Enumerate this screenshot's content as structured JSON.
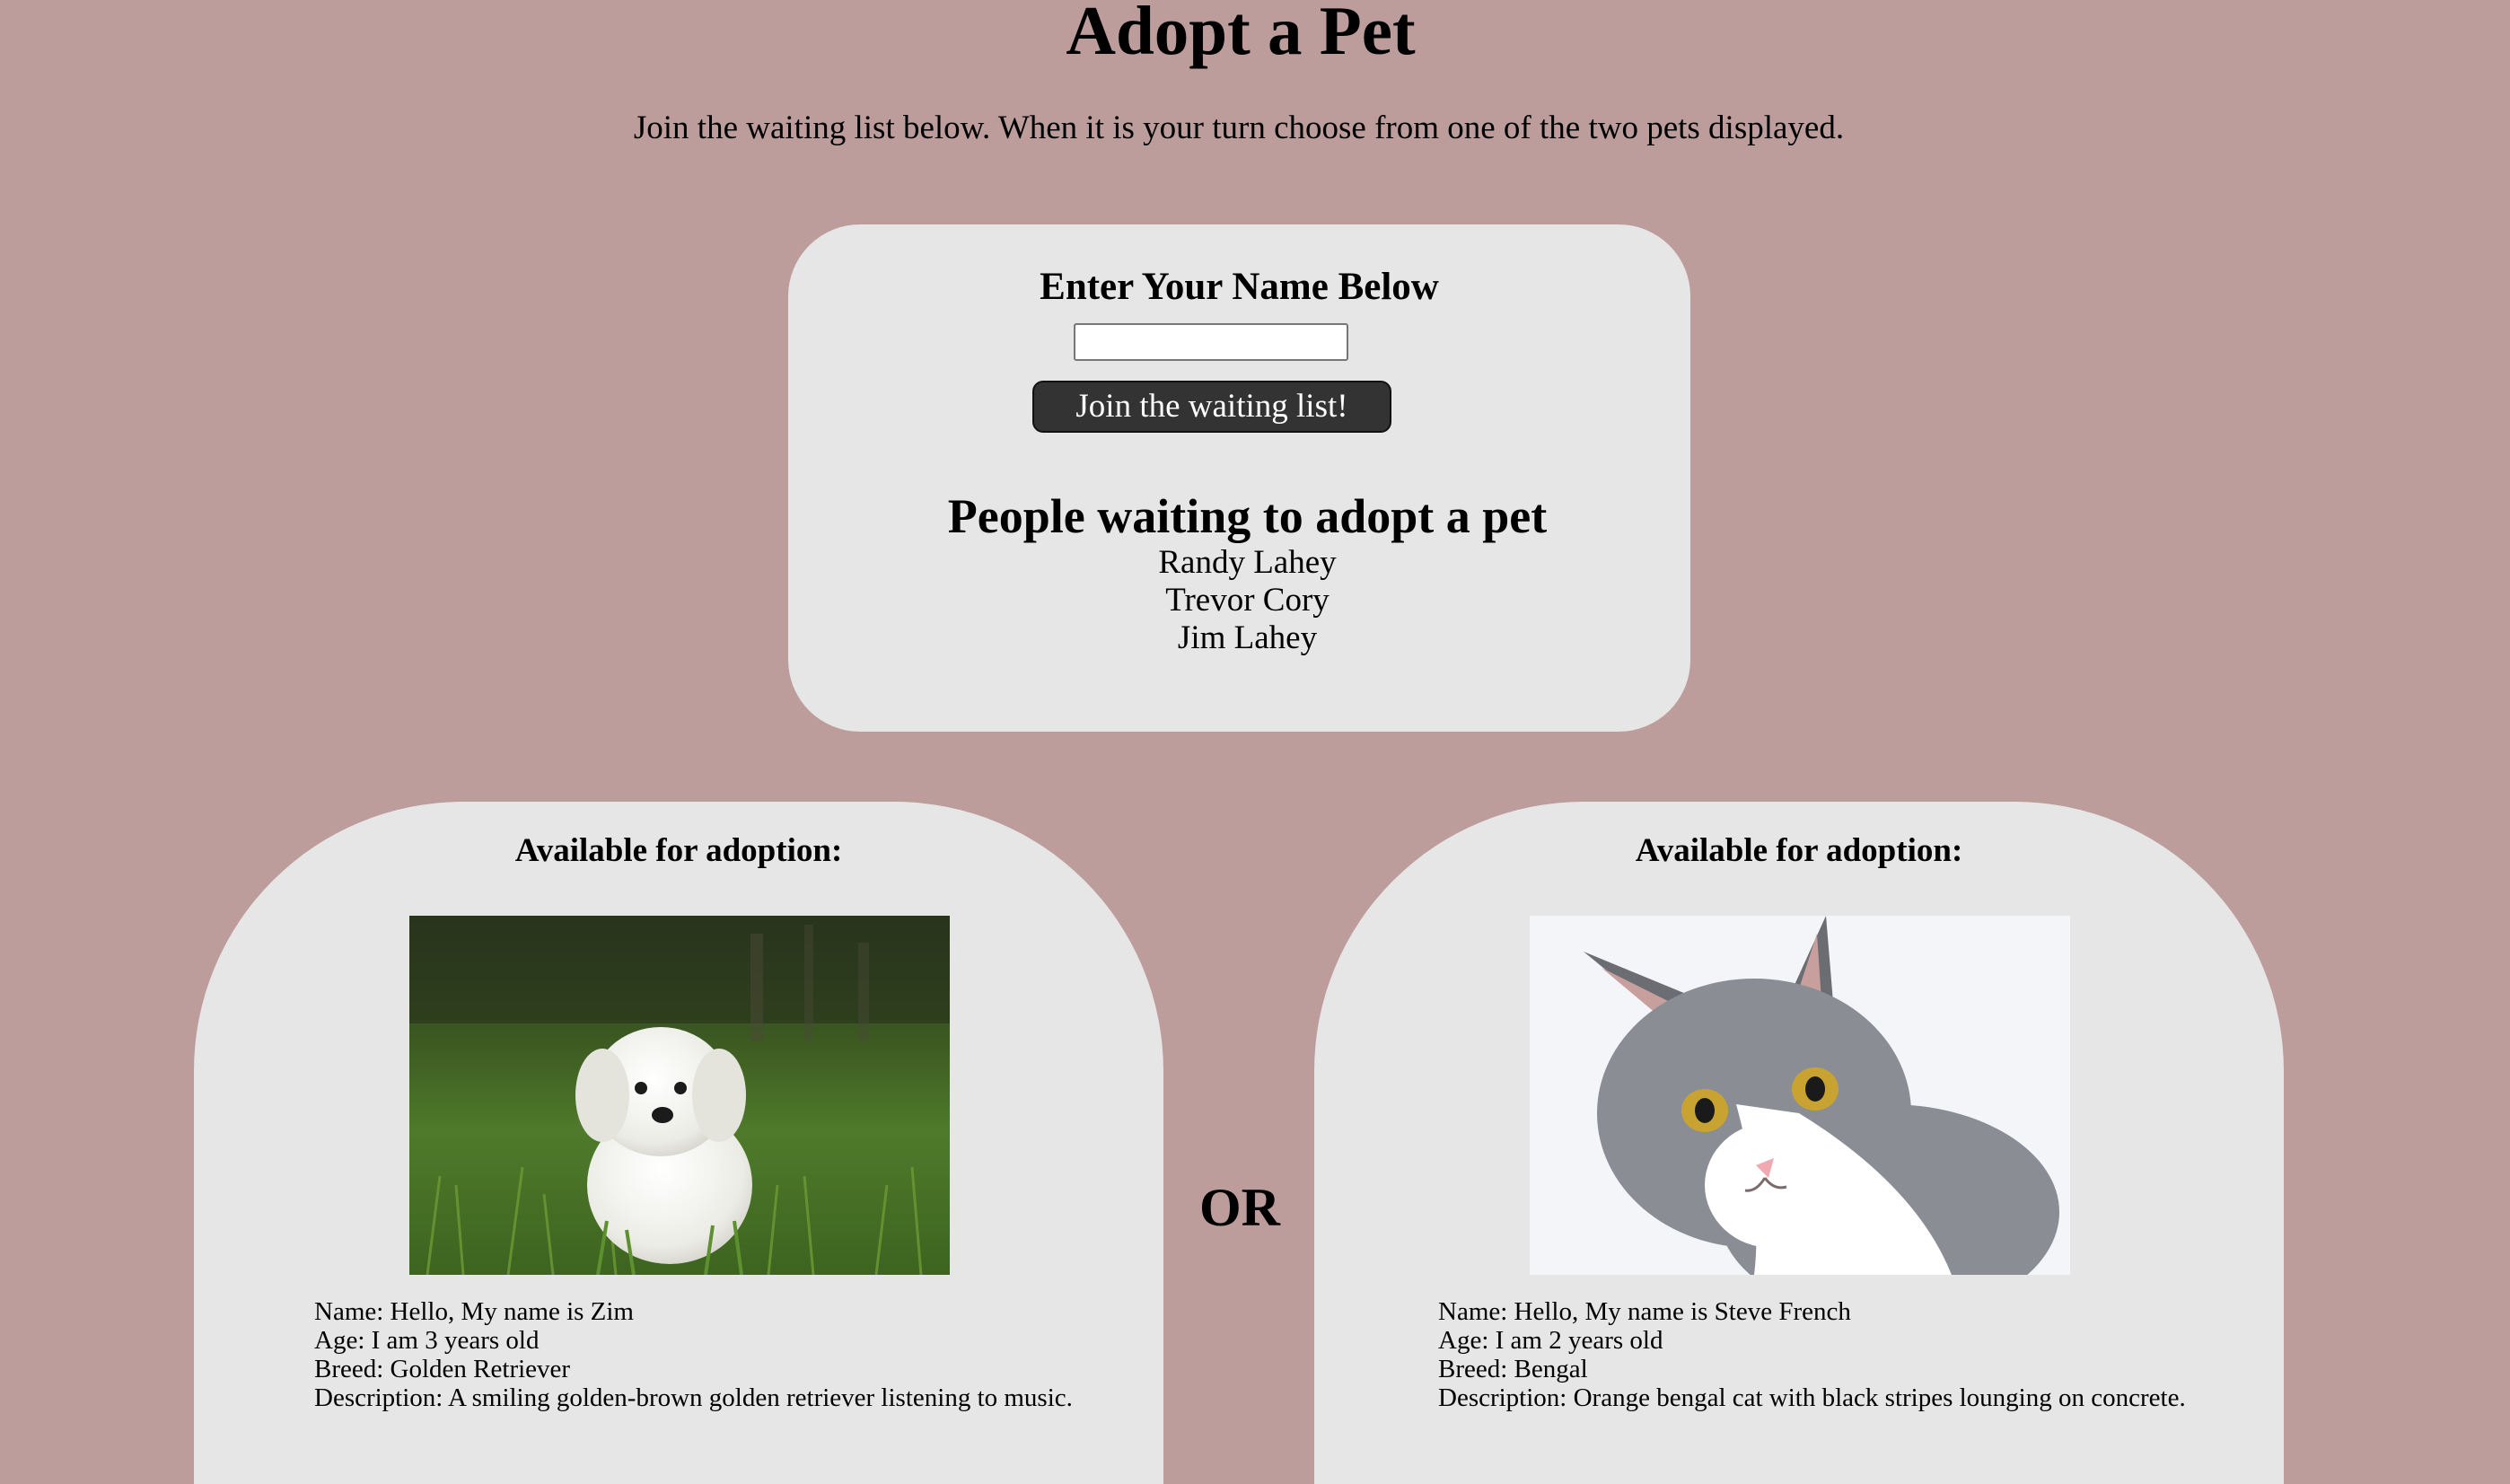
{
  "page": {
    "title": "Adopt a Pet",
    "intro": "Join the waiting list below. When it is your turn choose from one of the two pets displayed."
  },
  "waitlist": {
    "heading": "Enter Your Name Below",
    "name_input_value": "",
    "join_button_label": "Join the waiting list!",
    "queue_heading": "People waiting to adopt a pet",
    "people": [
      "Randy Lahey",
      "Trevor Cory",
      "Jim Lahey"
    ]
  },
  "separator": "OR",
  "pets": [
    {
      "heading": "Available for adoption:",
      "photo_icon": "white-puppy-in-grass-photo",
      "name_line": "Name: Hello, My name is Zim",
      "age_line": "Age: I am 3 years old",
      "breed_line": "Breed: Golden Retriever",
      "description_line": "Description: A smiling golden-brown golden retriever listening to music."
    },
    {
      "heading": "Available for adoption:",
      "photo_icon": "grey-white-cat-photo",
      "name_line": "Name: Hello, My name is Steve French",
      "age_line": "Age: I am 2 years old",
      "breed_line": "Breed: Bengal",
      "description_line": "Description: Orange bengal cat with black stripes lounging on concrete."
    }
  ],
  "colors": {
    "background": "#bd9d9c",
    "card": "#e6e6e6",
    "button": "#333333"
  }
}
